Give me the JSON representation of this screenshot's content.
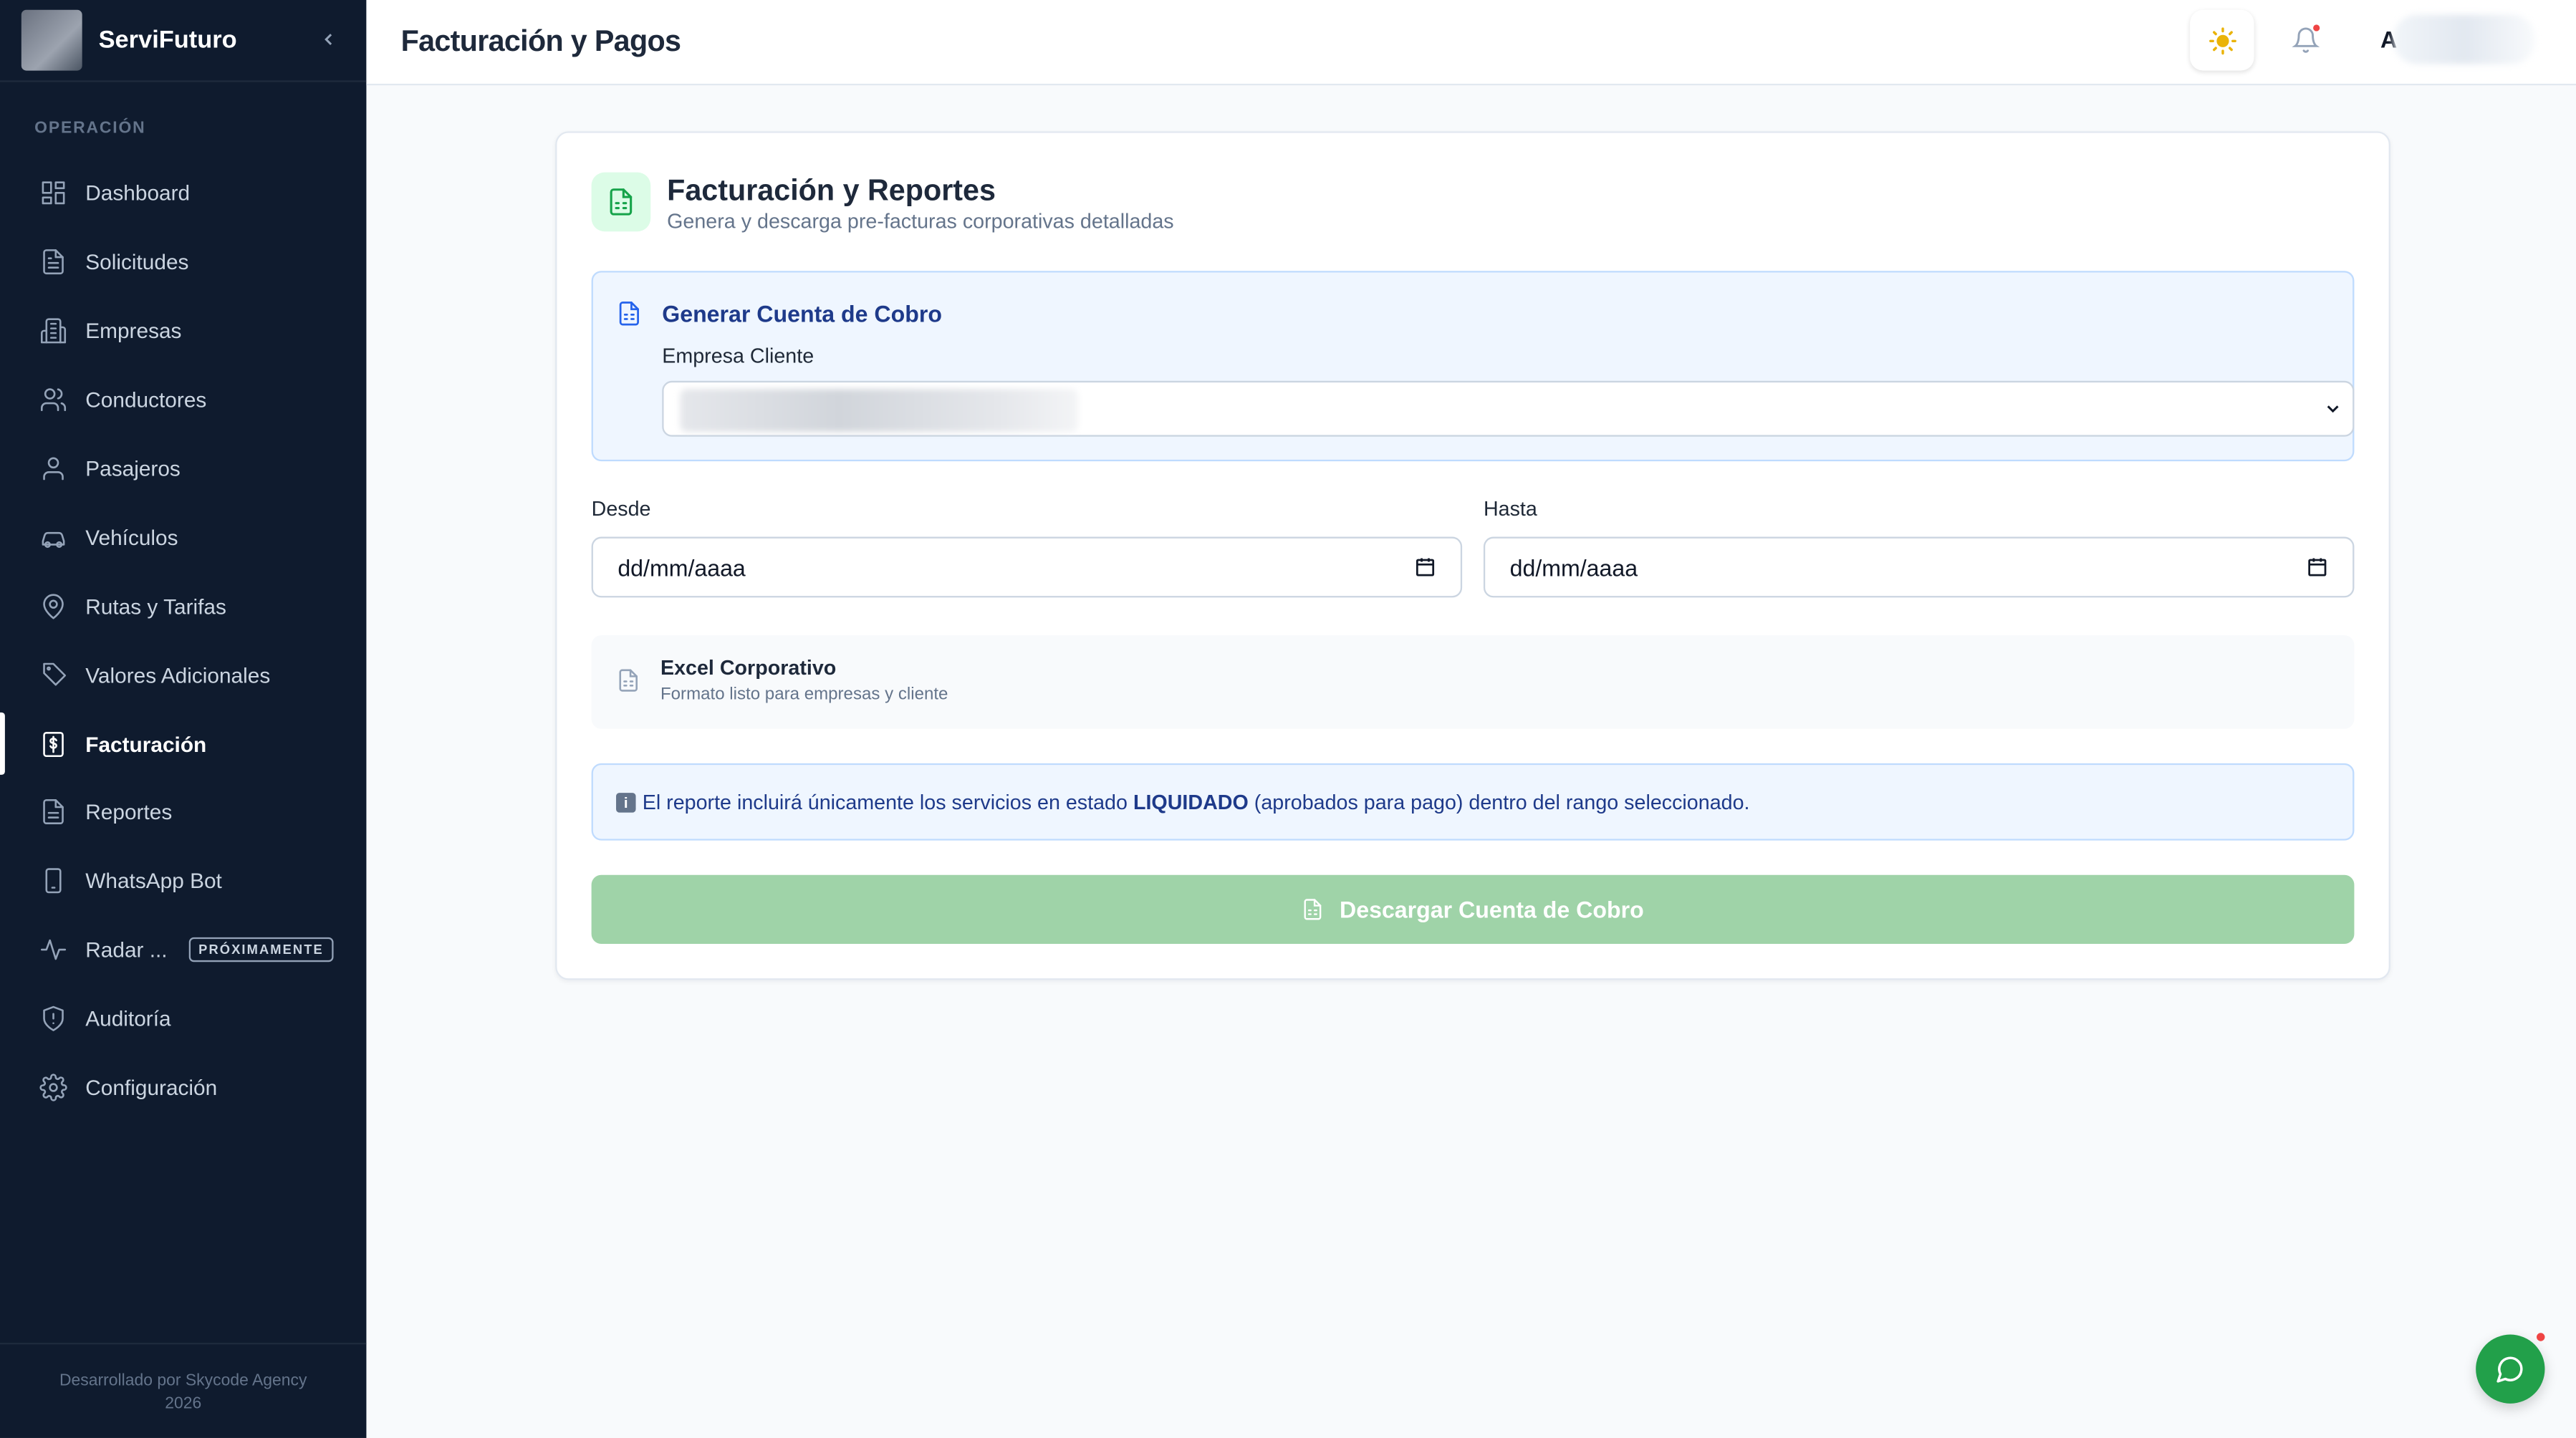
{
  "app": {
    "brand": "ServiFuturo",
    "header_title": "Facturación y Pagos",
    "avatar_initial": "A"
  },
  "sidebar": {
    "section_label": "OPERACIÓN",
    "items": [
      {
        "label": "Dashboard",
        "icon": "dashboard-icon"
      },
      {
        "label": "Solicitudes",
        "icon": "document-icon"
      },
      {
        "label": "Empresas",
        "icon": "building-icon"
      },
      {
        "label": "Conductores",
        "icon": "users-icon"
      },
      {
        "label": "Pasajeros",
        "icon": "user-icon"
      },
      {
        "label": "Vehículos",
        "icon": "car-icon"
      },
      {
        "label": "Rutas y Tarifas",
        "icon": "map-pin-icon"
      },
      {
        "label": "Valores Adicionales",
        "icon": "tag-icon"
      },
      {
        "label": "Facturación",
        "icon": "invoice-icon",
        "active": true
      },
      {
        "label": "Reportes",
        "icon": "report-icon"
      },
      {
        "label": "WhatsApp Bot",
        "icon": "phone-icon"
      },
      {
        "label": "Radar ...",
        "icon": "activity-icon",
        "badge": "PRÓXIMAMENTE"
      },
      {
        "label": "Auditoría",
        "icon": "shield-icon"
      },
      {
        "label": "Configuración",
        "icon": "gear-icon"
      }
    ],
    "footer_line1": "Desarrollado por Skycode Agency",
    "footer_line2": "2026"
  },
  "card": {
    "title": "Facturación y Reportes",
    "subtitle": "Genera y descarga pre-facturas corporativas detalladas",
    "generate": {
      "title": "Generar Cuenta de Cobro",
      "client_label": "Empresa Cliente"
    },
    "from_label": "Desde",
    "from_value": "dd/mm/aaaa",
    "to_label": "Hasta",
    "to_value": "dd/mm/aaaa",
    "excel": {
      "title": "Excel Corporativo",
      "subtitle": "Formato listo para empresas y cliente"
    },
    "info": {
      "pre": "El reporte incluirá únicamente los servicios en estado",
      "status": "LIQUIDADO",
      "post": "(aprobados para pago) dentro del rango seleccionado."
    },
    "download_label": "Descargar Cuenta de Cobro"
  },
  "colors": {
    "sidebar_bg": "#0f1b2e",
    "accent_green": "#22a04a",
    "button_disabled": "#9fd3a8",
    "info_blue": "#1e3a8a"
  }
}
